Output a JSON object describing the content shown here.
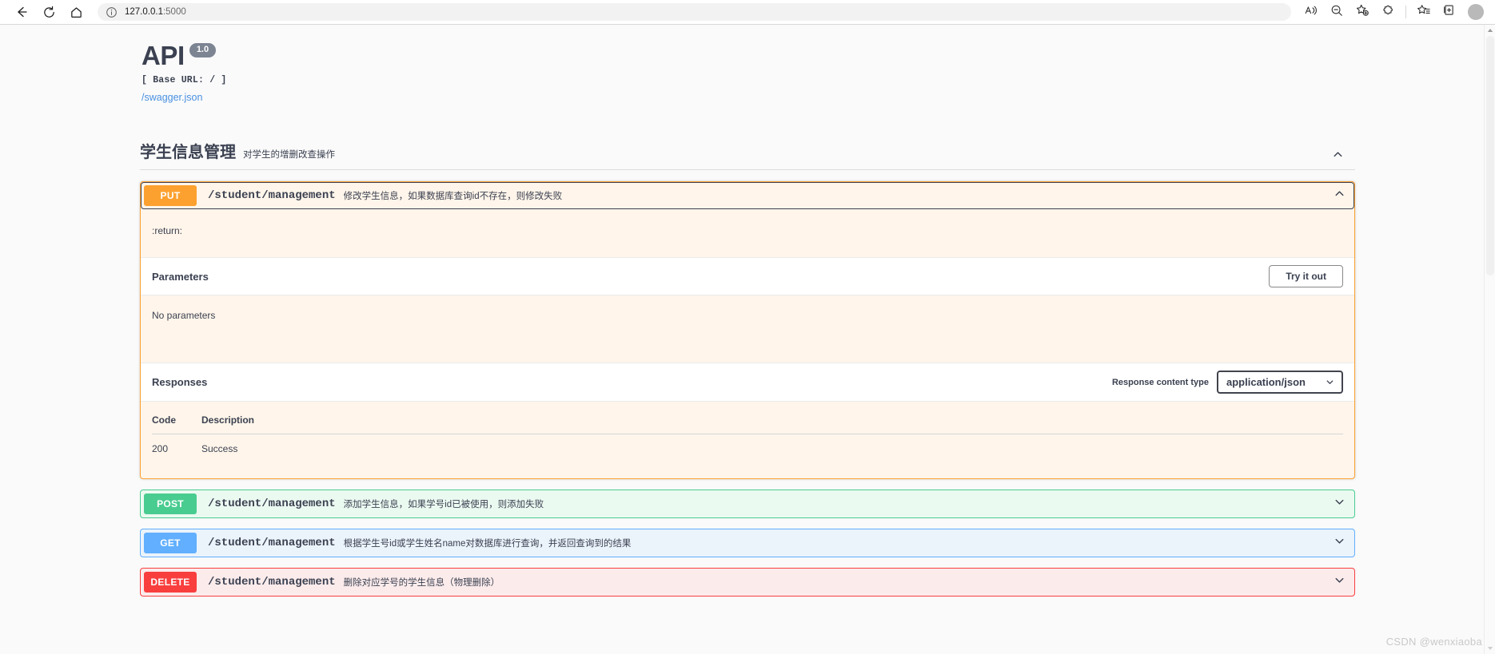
{
  "browser": {
    "back_label": "Back",
    "refresh_label": "Refresh",
    "home_label": "Home",
    "url_host": "127.0.0.1",
    "url_port": ":5000",
    "url_full": "127.0.0.1:5000",
    "icons": {
      "back": "back-arrow-icon",
      "refresh": "refresh-icon",
      "home": "home-icon",
      "site_info": "info-circle-icon",
      "read_aloud": "read-aloud-icon",
      "zoom_out": "zoom-out-icon",
      "add_favorite": "add-favorite-star-icon",
      "extensions": "extensions-puzzle-icon",
      "favorites": "favorites-list-icon",
      "collections": "collections-icon",
      "profile": "profile-avatar-icon"
    }
  },
  "api": {
    "title": "API",
    "version": "1.0",
    "base_url": "[ Base URL: / ]",
    "spec_link": "/swagger.json"
  },
  "tag": {
    "name": "学生信息管理",
    "description": "对学生的增删改查操作",
    "collapse_icon": "chevron-up-icon"
  },
  "operations": [
    {
      "method": "PUT",
      "method_key": "put",
      "path": "/student/management",
      "summary": "修改学生信息，如果数据库查询id不存在，则修改失败",
      "expanded": true,
      "toggle_icon": "chevron-up-icon",
      "body": {
        "return_text": ":return:",
        "parameters_title": "Parameters",
        "try_it_out_label": "Try it out",
        "no_parameters": "No parameters",
        "responses_title": "Responses",
        "content_type_label": "Response content type",
        "content_type_value": "application/json",
        "content_type_options": [
          "application/json"
        ],
        "table_headers": {
          "code": "Code",
          "description": "Description"
        },
        "rows": [
          {
            "code": "200",
            "description": "Success"
          }
        ]
      }
    },
    {
      "method": "POST",
      "method_key": "post",
      "path": "/student/management",
      "summary": "添加学生信息，如果学号id已被使用，则添加失败",
      "expanded": false,
      "toggle_icon": "chevron-down-icon"
    },
    {
      "method": "GET",
      "method_key": "get",
      "path": "/student/management",
      "summary": "根据学生号id或学生姓名name对数据库进行查询，并返回查询到的结果",
      "expanded": false,
      "toggle_icon": "chevron-down-icon"
    },
    {
      "method": "DELETE",
      "method_key": "delete",
      "path": "/student/management",
      "summary": "删除对应学号的学生信息（物理删除）",
      "expanded": false,
      "toggle_icon": "chevron-down-icon"
    }
  ],
  "watermark": "CSDN @wenxiaoba",
  "colors": {
    "put": "#fca130",
    "post": "#49cc90",
    "get": "#61affe",
    "delete": "#f93e3e",
    "text": "#3b4151",
    "link": "#4990e2",
    "version_badge": "#7d8492"
  }
}
